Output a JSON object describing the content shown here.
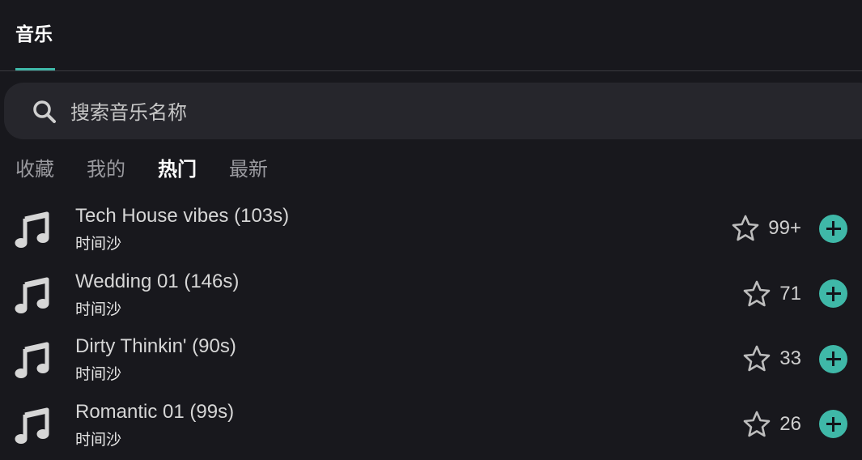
{
  "header": {
    "tab_label": "音乐"
  },
  "search": {
    "placeholder": "搜索音乐名称",
    "value": ""
  },
  "filters": [
    {
      "label": "收藏",
      "active": false
    },
    {
      "label": "我的",
      "active": false
    },
    {
      "label": "热门",
      "active": true
    },
    {
      "label": "最新",
      "active": false
    }
  ],
  "tracks": [
    {
      "title": "Tech House vibes (103s)",
      "author": "时间沙",
      "count": "99+"
    },
    {
      "title": "Wedding 01 (146s)",
      "author": "时间沙",
      "count": "71"
    },
    {
      "title": "Dirty Thinkin' (90s)",
      "author": "时间沙",
      "count": "33"
    },
    {
      "title": "Romantic 01 (99s)",
      "author": "时间沙",
      "count": "26"
    }
  ],
  "icons": {
    "search": "search-icon",
    "note": "music-note-icon",
    "star": "star-outline-icon",
    "add": "plus-circle-icon"
  },
  "colors": {
    "accent": "#3fb8a8",
    "background": "#18181d",
    "search_bg": "#26262c"
  }
}
